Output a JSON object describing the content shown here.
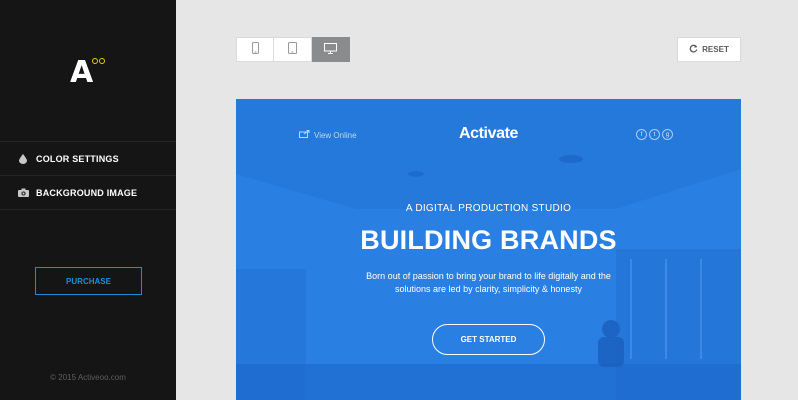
{
  "sidebar": {
    "logo_letter": "A",
    "menu": [
      {
        "label": "COLOR SETTINGS",
        "icon": "drop-icon"
      },
      {
        "label": "BACKGROUND IMAGE",
        "icon": "camera-icon"
      }
    ],
    "purchase_label": "PURCHASE",
    "copyright": "© 2015 Activeoo.com"
  },
  "toolbar": {
    "devices": [
      {
        "icon": "phone-icon",
        "active": false
      },
      {
        "icon": "tablet-icon",
        "active": false
      },
      {
        "icon": "desktop-icon",
        "active": true
      }
    ],
    "reset_label": "RESET",
    "reset_icon": "refresh-icon"
  },
  "preview": {
    "view_online": "View Online",
    "brand": "Activate",
    "socials": [
      {
        "glyph": "f",
        "icon": "facebook-icon"
      },
      {
        "glyph": "t",
        "icon": "twitter-icon"
      },
      {
        "glyph": "g",
        "icon": "google-plus-icon"
      }
    ],
    "eyebrow": "A DIGITAL PRODUCTION STUDIO",
    "headline": "BUILDING BRANDS",
    "body": "Born out of passion to bring your brand to life digitally and the solutions are led by clarity, simplicity & honesty",
    "cta": "GET STARTED"
  },
  "colors": {
    "sidebar_bg": "#151516",
    "accent_blue": "#1a8fd6",
    "logo_yellow": "#f5c518",
    "preview_blue": "#2a7fe2"
  }
}
